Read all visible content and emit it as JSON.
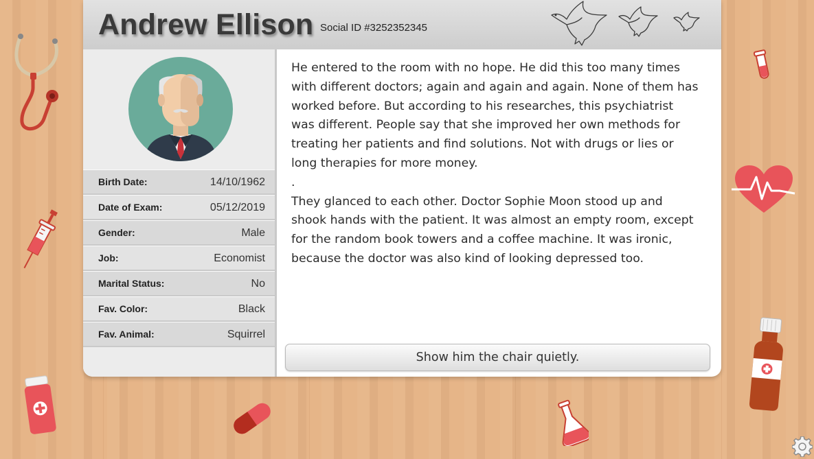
{
  "patient": {
    "name": "Andrew Ellison",
    "social_id": "Social ID #3252352345"
  },
  "details": [
    {
      "label": "Birth Date:",
      "value": "14/10/1962"
    },
    {
      "label": "Date of Exam:",
      "value": "05/12/2019"
    },
    {
      "label": "Gender:",
      "value": "Male"
    },
    {
      "label": "Job:",
      "value": "Economist"
    },
    {
      "label": "Marital Status:",
      "value": "No"
    },
    {
      "label": "Fav. Color:",
      "value": "Black"
    },
    {
      "label": "Fav. Animal:",
      "value": "Squirrel"
    }
  ],
  "story": {
    "paragraph1": "He entered to the room with no hope. He did this too many times with different doctors; again and again and again. None of them has worked before. But according to his researches, this psychiatrist was different. People say that she improved her own methods for treating her patients and find solutions. Not with drugs or lies or long therapies for more money.",
    "separator": ".",
    "paragraph2": "They glanced to each other. Doctor Sophie Moon stood up and shook hands with the patient. It was almost an empty room, except for the random book towers and a coffee machine. It was ironic, because the doctor was also kind of looking depressed too."
  },
  "choice": {
    "label": "Show him the chair quietly."
  },
  "icons": {
    "birds": "dove-icon",
    "avatar": "old-man-avatar",
    "settings": "gear-icon"
  },
  "colors": {
    "table": "#e6b486",
    "avatar_bg": "#6aab9a",
    "medical_red": "#e8545a"
  }
}
